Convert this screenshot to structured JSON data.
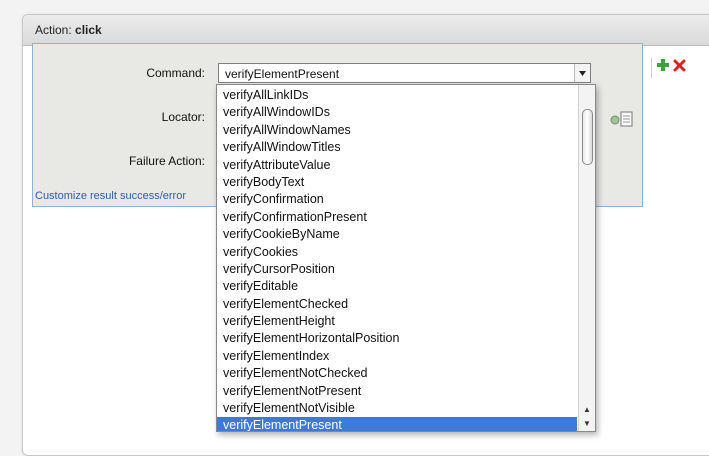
{
  "panel": {
    "title_prefix": "Action:",
    "title_action": "click"
  },
  "form": {
    "command_label": "Command:",
    "locator_label": "Locator:",
    "failure_action_label": "Failure Action:",
    "customize_link": "Customize result success/error"
  },
  "command_select": {
    "value": "verifyElementPresent",
    "options": [
      "verifyAllLinkIDs",
      "verifyAllWindowIDs",
      "verifyAllWindowNames",
      "verifyAllWindowTitles",
      "verifyAttributeValue",
      "verifyBodyText",
      "verifyConfirmation",
      "verifyConfirmationPresent",
      "verifyCookieByName",
      "verifyCookies",
      "verifyCursorPosition",
      "verifyEditable",
      "verifyElementChecked",
      "verifyElementHeight",
      "verifyElementHorizontalPosition",
      "verifyElementIndex",
      "verifyElementNotChecked",
      "verifyElementNotPresent",
      "verifyElementNotVisible",
      "verifyElementPresent"
    ],
    "selected_index": 19
  },
  "icons": {
    "add": "plus-icon",
    "remove": "close-icon",
    "locator_tools": "locator-picker-icon"
  },
  "colors": {
    "selection": "#3d79d9",
    "form_border": "#8bb3d9",
    "link": "#2a5db0",
    "add": "#3aa63a",
    "remove": "#d8231d"
  }
}
